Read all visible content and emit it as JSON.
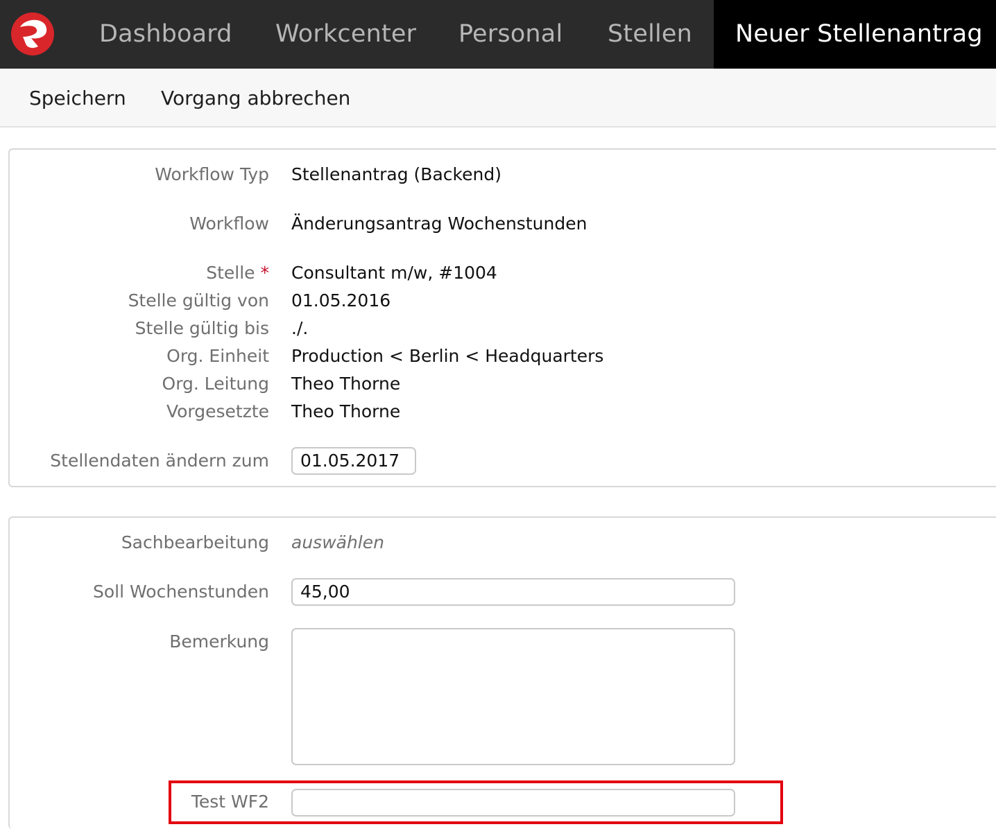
{
  "nav": {
    "items": [
      {
        "label": "Dashboard"
      },
      {
        "label": "Workcenter"
      },
      {
        "label": "Personal"
      },
      {
        "label": "Stellen"
      },
      {
        "label": "Neuer Stellenantrag",
        "active": true
      }
    ],
    "logo_icon": "red-swirl-logo",
    "logo_color": "#d9262a"
  },
  "toolbar": {
    "save_label": "Speichern",
    "cancel_label": "Vorgang abbrechen"
  },
  "section1": {
    "workflow_typ": {
      "label": "Workflow Typ",
      "value": "Stellenantrag (Backend)"
    },
    "workflow": {
      "label": "Workflow",
      "value": "Änderungsantrag Wochenstunden"
    },
    "stelle": {
      "label": "Stelle",
      "required_mark": "*",
      "value": "Consultant m/w, #1004"
    },
    "gueltig_von": {
      "label": "Stelle gültig von",
      "value": "01.05.2016"
    },
    "gueltig_bis": {
      "label": "Stelle gültig bis",
      "value": "./."
    },
    "org_einheit": {
      "label": "Org. Einheit",
      "value": "Production < Berlin < Headquarters"
    },
    "org_leitung": {
      "label": "Org. Leitung",
      "value": "Theo Thorne"
    },
    "vorgesetzte": {
      "label": "Vorgesetzte",
      "value": "Theo Thorne"
    },
    "aendern_zum": {
      "label": "Stellendaten ändern zum",
      "value": "01.05.2017"
    }
  },
  "section2": {
    "sachbearbeitung": {
      "label": "Sachbearbeitung",
      "value": "auswählen"
    },
    "soll_wochenstunden": {
      "label": "Soll Wochenstunden",
      "value": "45,00"
    },
    "bemerkung": {
      "label": "Bemerkung",
      "value": ""
    },
    "test_wf2": {
      "label": "Test WF2",
      "value": ""
    }
  },
  "colors": {
    "highlight": "#e3000f",
    "required": "#c8102e"
  }
}
